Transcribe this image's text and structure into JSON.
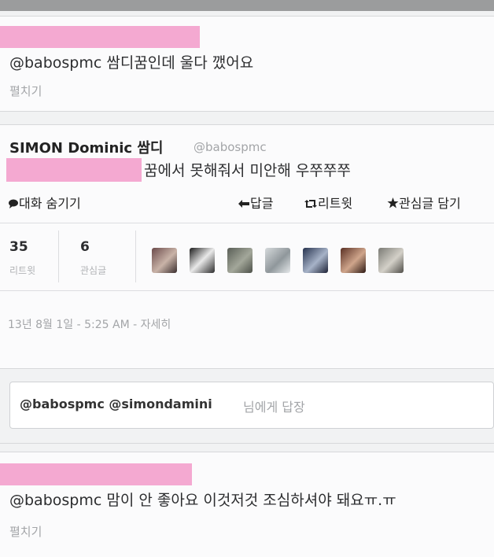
{
  "tweet1": {
    "text": "@babospmc 쌈디꿈인데 울다 깼어요",
    "expand": "펼치기"
  },
  "main_tweet": {
    "name": "SIMON Dominic 쌈디",
    "handle": "@babospmc",
    "text": "꿈에서 못해줘서 미안해 우쭈쭈쭈",
    "hide_conversation": "대화 숨기기",
    "reply": "답글",
    "retweet": "리트윗",
    "favorite": "관심글 담기",
    "retweets_count": "35",
    "retweets_label": "리트윗",
    "favorites_count": "6",
    "favorites_label": "관심글",
    "timestamp": "13년 8월 1일 - 5:25 AM - 자세히"
  },
  "reply_box": {
    "mentions": "@babospmc @simondamini",
    "placeholder": "님에게 답장"
  },
  "tweet3": {
    "text": "@babospmc 맘이 안 좋아요 이것저것 조심하셔야 돼요ㅠ.ㅠ",
    "expand": "펼치기"
  },
  "colors": {
    "redaction": "#f4a9d1",
    "background": "#f1f2f3",
    "card": "#fbfbfc"
  },
  "avatars": [
    "avatar-1",
    "avatar-2",
    "avatar-3",
    "avatar-4",
    "avatar-5",
    "avatar-6",
    "avatar-7"
  ]
}
